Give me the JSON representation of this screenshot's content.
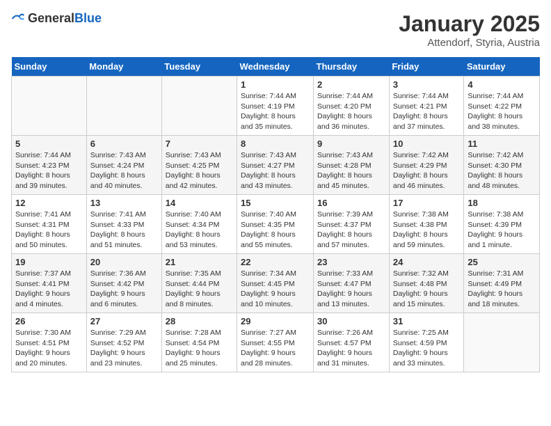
{
  "logo": {
    "general": "General",
    "blue": "Blue"
  },
  "header": {
    "month": "January 2025",
    "location": "Attendorf, Styria, Austria"
  },
  "weekdays": [
    "Sunday",
    "Monday",
    "Tuesday",
    "Wednesday",
    "Thursday",
    "Friday",
    "Saturday"
  ],
  "weeks": [
    [
      {
        "day": "",
        "info": ""
      },
      {
        "day": "",
        "info": ""
      },
      {
        "day": "",
        "info": ""
      },
      {
        "day": "1",
        "info": "Sunrise: 7:44 AM\nSunset: 4:19 PM\nDaylight: 8 hours and 35 minutes."
      },
      {
        "day": "2",
        "info": "Sunrise: 7:44 AM\nSunset: 4:20 PM\nDaylight: 8 hours and 36 minutes."
      },
      {
        "day": "3",
        "info": "Sunrise: 7:44 AM\nSunset: 4:21 PM\nDaylight: 8 hours and 37 minutes."
      },
      {
        "day": "4",
        "info": "Sunrise: 7:44 AM\nSunset: 4:22 PM\nDaylight: 8 hours and 38 minutes."
      }
    ],
    [
      {
        "day": "5",
        "info": "Sunrise: 7:44 AM\nSunset: 4:23 PM\nDaylight: 8 hours and 39 minutes."
      },
      {
        "day": "6",
        "info": "Sunrise: 7:43 AM\nSunset: 4:24 PM\nDaylight: 8 hours and 40 minutes."
      },
      {
        "day": "7",
        "info": "Sunrise: 7:43 AM\nSunset: 4:25 PM\nDaylight: 8 hours and 42 minutes."
      },
      {
        "day": "8",
        "info": "Sunrise: 7:43 AM\nSunset: 4:27 PM\nDaylight: 8 hours and 43 minutes."
      },
      {
        "day": "9",
        "info": "Sunrise: 7:43 AM\nSunset: 4:28 PM\nDaylight: 8 hours and 45 minutes."
      },
      {
        "day": "10",
        "info": "Sunrise: 7:42 AM\nSunset: 4:29 PM\nDaylight: 8 hours and 46 minutes."
      },
      {
        "day": "11",
        "info": "Sunrise: 7:42 AM\nSunset: 4:30 PM\nDaylight: 8 hours and 48 minutes."
      }
    ],
    [
      {
        "day": "12",
        "info": "Sunrise: 7:41 AM\nSunset: 4:31 PM\nDaylight: 8 hours and 50 minutes."
      },
      {
        "day": "13",
        "info": "Sunrise: 7:41 AM\nSunset: 4:33 PM\nDaylight: 8 hours and 51 minutes."
      },
      {
        "day": "14",
        "info": "Sunrise: 7:40 AM\nSunset: 4:34 PM\nDaylight: 8 hours and 53 minutes."
      },
      {
        "day": "15",
        "info": "Sunrise: 7:40 AM\nSunset: 4:35 PM\nDaylight: 8 hours and 55 minutes."
      },
      {
        "day": "16",
        "info": "Sunrise: 7:39 AM\nSunset: 4:37 PM\nDaylight: 8 hours and 57 minutes."
      },
      {
        "day": "17",
        "info": "Sunrise: 7:38 AM\nSunset: 4:38 PM\nDaylight: 8 hours and 59 minutes."
      },
      {
        "day": "18",
        "info": "Sunrise: 7:38 AM\nSunset: 4:39 PM\nDaylight: 9 hours and 1 minute."
      }
    ],
    [
      {
        "day": "19",
        "info": "Sunrise: 7:37 AM\nSunset: 4:41 PM\nDaylight: 9 hours and 4 minutes."
      },
      {
        "day": "20",
        "info": "Sunrise: 7:36 AM\nSunset: 4:42 PM\nDaylight: 9 hours and 6 minutes."
      },
      {
        "day": "21",
        "info": "Sunrise: 7:35 AM\nSunset: 4:44 PM\nDaylight: 9 hours and 8 minutes."
      },
      {
        "day": "22",
        "info": "Sunrise: 7:34 AM\nSunset: 4:45 PM\nDaylight: 9 hours and 10 minutes."
      },
      {
        "day": "23",
        "info": "Sunrise: 7:33 AM\nSunset: 4:47 PM\nDaylight: 9 hours and 13 minutes."
      },
      {
        "day": "24",
        "info": "Sunrise: 7:32 AM\nSunset: 4:48 PM\nDaylight: 9 hours and 15 minutes."
      },
      {
        "day": "25",
        "info": "Sunrise: 7:31 AM\nSunset: 4:49 PM\nDaylight: 9 hours and 18 minutes."
      }
    ],
    [
      {
        "day": "26",
        "info": "Sunrise: 7:30 AM\nSunset: 4:51 PM\nDaylight: 9 hours and 20 minutes."
      },
      {
        "day": "27",
        "info": "Sunrise: 7:29 AM\nSunset: 4:52 PM\nDaylight: 9 hours and 23 minutes."
      },
      {
        "day": "28",
        "info": "Sunrise: 7:28 AM\nSunset: 4:54 PM\nDaylight: 9 hours and 25 minutes."
      },
      {
        "day": "29",
        "info": "Sunrise: 7:27 AM\nSunset: 4:55 PM\nDaylight: 9 hours and 28 minutes."
      },
      {
        "day": "30",
        "info": "Sunrise: 7:26 AM\nSunset: 4:57 PM\nDaylight: 9 hours and 31 minutes."
      },
      {
        "day": "31",
        "info": "Sunrise: 7:25 AM\nSunset: 4:59 PM\nDaylight: 9 hours and 33 minutes."
      },
      {
        "day": "",
        "info": ""
      }
    ]
  ]
}
